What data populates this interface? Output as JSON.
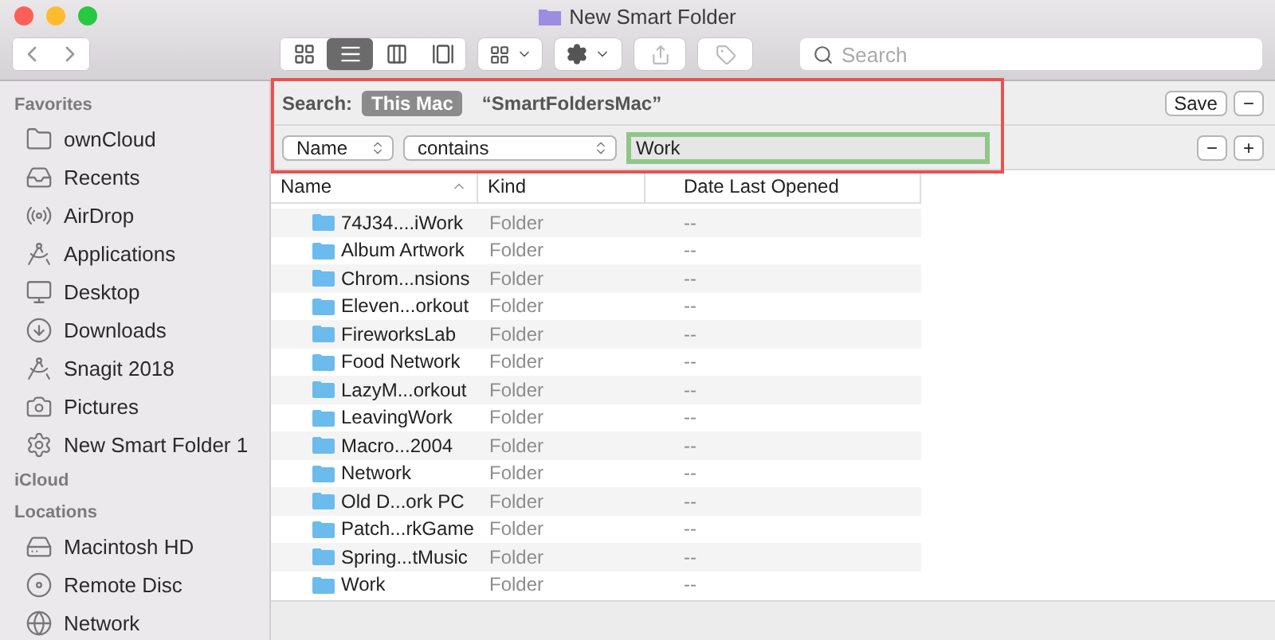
{
  "window": {
    "title": "New Smart Folder"
  },
  "toolbar": {
    "view_buttons": [
      {
        "kind": "icons",
        "selected": false
      },
      {
        "kind": "list",
        "selected": true
      },
      {
        "kind": "columns",
        "selected": false
      },
      {
        "kind": "gallery",
        "selected": false
      }
    ],
    "search": {
      "placeholder": "Search"
    }
  },
  "sidebar": {
    "sections": [
      {
        "title": "Favorites",
        "items": [
          {
            "kind": "folder",
            "label": "ownCloud"
          },
          {
            "kind": "recents",
            "label": "Recents"
          },
          {
            "kind": "airdrop",
            "label": "AirDrop"
          },
          {
            "kind": "apps",
            "label": "Applications"
          },
          {
            "kind": "desktop",
            "label": "Desktop"
          },
          {
            "kind": "downloads",
            "label": "Downloads"
          },
          {
            "kind": "apps",
            "label": "Snagit 2018"
          },
          {
            "kind": "pictures",
            "label": "Pictures"
          },
          {
            "kind": "smart",
            "label": "New Smart Folder 1"
          }
        ]
      },
      {
        "title": "iCloud"
      },
      {
        "title": "Locations",
        "items": [
          {
            "kind": "disk",
            "label": "Macintosh HD"
          },
          {
            "kind": "disc",
            "label": "Remote Disc"
          },
          {
            "kind": "network",
            "label": "Network"
          }
        ]
      }
    ]
  },
  "search_bar": {
    "label": "Search:",
    "scopes": [
      {
        "label": "This Mac",
        "selected": true
      },
      {
        "label": "“SmartFoldersMac”",
        "selected": false
      }
    ],
    "save": "Save",
    "remove": "−"
  },
  "criteria": {
    "attribute": "Name",
    "operator": "contains",
    "value": "Work",
    "remove": "−",
    "add": "+"
  },
  "table": {
    "columns": [
      "Name",
      "Kind",
      "Date Last Opened"
    ],
    "rows": [
      {
        "name": "74J34....iWork",
        "kind": "Folder",
        "date": "--"
      },
      {
        "name": "Album Artwork",
        "kind": "Folder",
        "date": "--"
      },
      {
        "name": "Chrom...nsions",
        "kind": "Folder",
        "date": "--"
      },
      {
        "name": "Eleven...orkout",
        "kind": "Folder",
        "date": "--"
      },
      {
        "name": "FireworksLab",
        "kind": "Folder",
        "date": "--"
      },
      {
        "name": "Food Network",
        "kind": "Folder",
        "date": "--"
      },
      {
        "name": "LazyM...orkout",
        "kind": "Folder",
        "date": "--"
      },
      {
        "name": "LeavingWork",
        "kind": "Folder",
        "date": "--"
      },
      {
        "name": "Macro...2004",
        "kind": "Folder",
        "date": "--"
      },
      {
        "name": "Network",
        "kind": "Folder",
        "date": "--"
      },
      {
        "name": "Old D...ork PC",
        "kind": "Folder",
        "date": "--"
      },
      {
        "name": "Patch...rkGame",
        "kind": "Folder",
        "date": "--"
      },
      {
        "name": "Spring...tMusic",
        "kind": "Folder",
        "date": "--"
      },
      {
        "name": "Work",
        "kind": "Folder",
        "date": "--"
      }
    ]
  }
}
